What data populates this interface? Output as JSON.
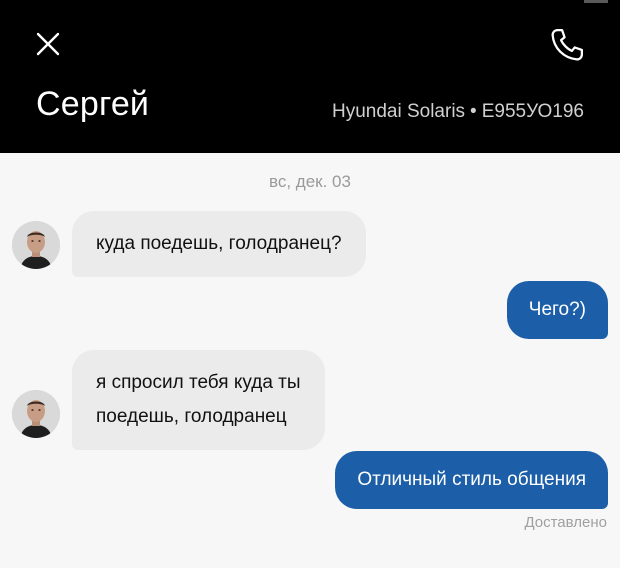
{
  "header": {
    "contact_name": "Сергей",
    "vehicle_model": "Hyundai Solaris",
    "separator": "•",
    "plate": "Е955УО196",
    "close_icon": "close-icon",
    "call_icon": "phone-icon"
  },
  "chat": {
    "date": "вс, дек. 03",
    "messages": [
      {
        "direction": "incoming",
        "text": "куда поедешь, голодранец?"
      },
      {
        "direction": "outgoing",
        "text": "Чего?)"
      },
      {
        "direction": "incoming",
        "text_line1": "я спросил тебя куда ты",
        "text_line2": "поедешь, голодранец"
      },
      {
        "direction": "outgoing",
        "text": "Отличный стиль общения"
      }
    ],
    "status": "Доставлено"
  },
  "colors": {
    "header_bg": "#000000",
    "chat_bg": "#f7f7f7",
    "incoming_bubble": "#ebebeb",
    "outgoing_bubble": "#1c5fa8"
  }
}
